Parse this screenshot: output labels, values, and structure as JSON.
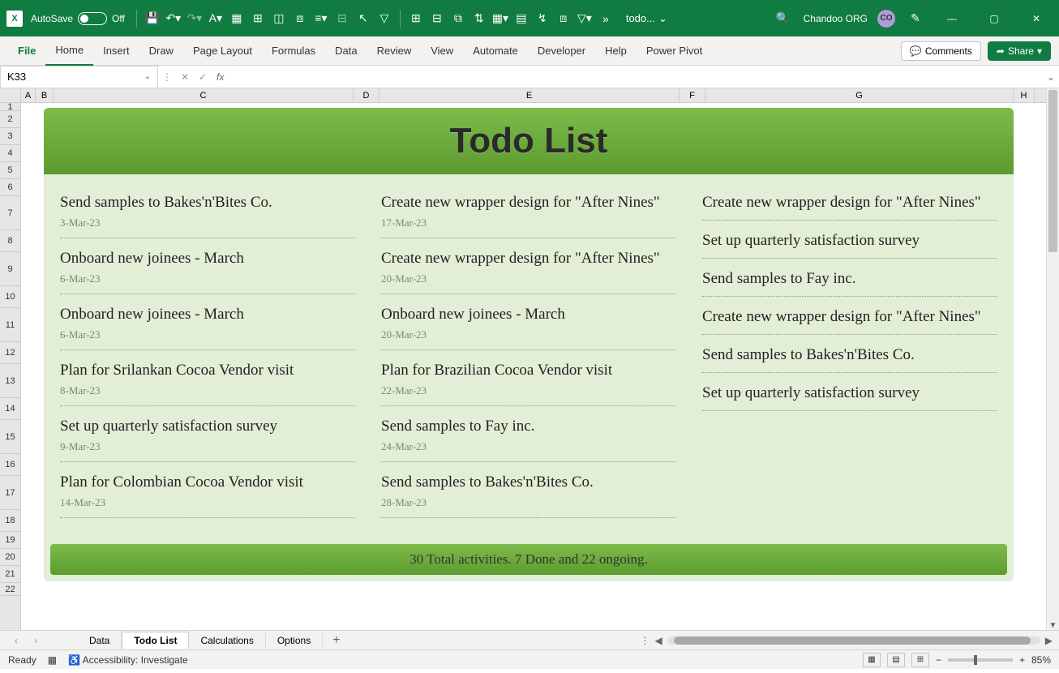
{
  "titlebar": {
    "autosave_label": "AutoSave",
    "autosave_state": "Off",
    "filename": "todo...",
    "search_icon": "search",
    "org_name": "Chandoo ORG",
    "user_initials": "CO"
  },
  "ribbon": {
    "tabs": [
      "File",
      "Home",
      "Insert",
      "Draw",
      "Page Layout",
      "Formulas",
      "Data",
      "Review",
      "View",
      "Automate",
      "Developer",
      "Help",
      "Power Pivot"
    ],
    "comments_label": "Comments",
    "share_label": "Share"
  },
  "formula_bar": {
    "name_box": "K33",
    "formula": ""
  },
  "columns": [
    "A",
    "B",
    "C",
    "D",
    "E",
    "F",
    "G",
    "H"
  ],
  "rows": [
    "1",
    "2",
    "3",
    "4",
    "5",
    "6",
    "7",
    "8",
    "9",
    "10",
    "11",
    "12",
    "13",
    "14",
    "15",
    "16",
    "17",
    "18",
    "19",
    "20",
    "21",
    "22"
  ],
  "todo": {
    "title": "Todo List",
    "col1": [
      {
        "task": "Send samples to Bakes'n'Bites Co.",
        "date": "3-Mar-23"
      },
      {
        "task": "Onboard new joinees - March",
        "date": "6-Mar-23"
      },
      {
        "task": "Onboard new joinees - March",
        "date": "6-Mar-23"
      },
      {
        "task": "Plan for Srilankan Cocoa Vendor visit",
        "date": "8-Mar-23"
      },
      {
        "task": "Set up quarterly satisfaction survey",
        "date": "9-Mar-23"
      },
      {
        "task": "Plan for Colombian Cocoa Vendor visit",
        "date": "14-Mar-23"
      }
    ],
    "col2": [
      {
        "task": "Create new wrapper design for \"After Nines\"",
        "date": "17-Mar-23"
      },
      {
        "task": "Create new wrapper design for \"After Nines\"",
        "date": "20-Mar-23"
      },
      {
        "task": "Onboard new joinees - March",
        "date": "20-Mar-23"
      },
      {
        "task": "Plan for Brazilian Cocoa Vendor visit",
        "date": "22-Mar-23"
      },
      {
        "task": "Send samples to Fay inc.",
        "date": "24-Mar-23"
      },
      {
        "task": "Send samples to Bakes'n'Bites Co.",
        "date": "28-Mar-23"
      }
    ],
    "col3": [
      {
        "task": "Create new wrapper design for \"After Nines\"",
        "date": ""
      },
      {
        "task": "Set up quarterly satisfaction survey",
        "date": ""
      },
      {
        "task": "Send samples to Fay inc.",
        "date": ""
      },
      {
        "task": "Create new wrapper design for \"After Nines\"",
        "date": ""
      },
      {
        "task": "Send samples to Bakes'n'Bites Co.",
        "date": ""
      },
      {
        "task": "Set up quarterly satisfaction survey",
        "date": ""
      }
    ],
    "footer": "30 Total activities. 7 Done and 22 ongoing."
  },
  "sheet_tabs": [
    "Data",
    "Todo List",
    "Calculations",
    "Options"
  ],
  "active_sheet": "Todo List",
  "statusbar": {
    "ready": "Ready",
    "accessibility": "Accessibility: Investigate",
    "zoom": "85%"
  }
}
